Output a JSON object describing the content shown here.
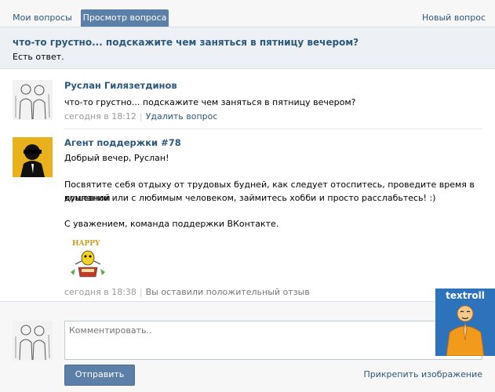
{
  "tabs": {
    "my_questions": "Мои вопросы",
    "view_question": "Просмотр вопроса",
    "new_question": "Новый вопрос"
  },
  "question": {
    "title": "что-то грустно... подскажите чем заняться в пятницу вечером?",
    "status": "Есть ответ."
  },
  "posts": [
    {
      "author": "Руслан Гилязетдинов",
      "text": "что-то грустно... подскажите чем заняться в пятницу вечером?",
      "time": "сегодня в 18:12",
      "action": "Удалить вопрос"
    },
    {
      "author": "Агент поддержки #78",
      "greeting": "Добрый вечер, Руслан!",
      "body_line1": "Посвятите себя отдыху от трудовых будней, как следует отоспитесь, проведите время в душевной",
      "body_line2": "компании или с любимым человеком, займитесь хобби и просто расслабьтесь! :)",
      "signature": "С уважением, команда поддержки ВКонтакте.",
      "sticker_text": "HAPPY",
      "time": "сегодня в 18:38",
      "note": "Вы оставили положительный отзыв"
    }
  ],
  "comment": {
    "placeholder": "Комментировать..",
    "send_label": "Отправить",
    "attach_label": "Прикрепить изображение"
  },
  "watermark": "textroll",
  "colors": {
    "link": "#2b587a",
    "button": "#5b7fa6",
    "header_bg": "#edf1f5",
    "watermark_bg": "#2c73bc"
  }
}
